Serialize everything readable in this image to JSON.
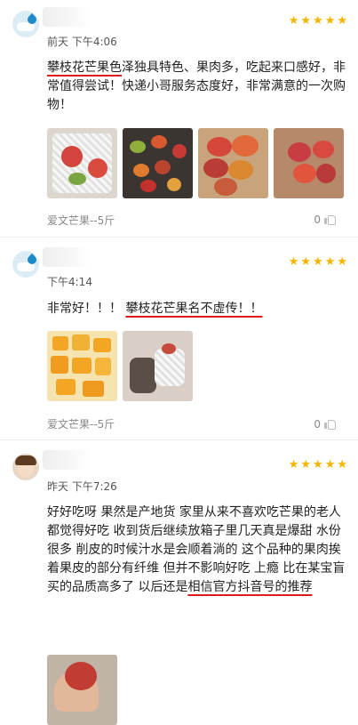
{
  "reviews": [
    {
      "date": "前天 下午4:06",
      "text_parts": [
        {
          "text": "攀枝花芒果色",
          "underline": true
        },
        {
          "text": "泽独具特色、果肉多，吃起来口感好，非常值得尝试！快递小哥服务态度好，非常满意的一次购物！",
          "underline": false
        }
      ],
      "variant": "爱文芒果--5斤",
      "likes": "0",
      "image_count": 4
    },
    {
      "date": "下午4:14",
      "text_parts": [
        {
          "text": "非常好！！！ ",
          "underline": false
        },
        {
          "text": "攀枝花芒果名不虚传！！",
          "underline": true
        }
      ],
      "variant": "爱文芒果--5斤",
      "likes": "0",
      "image_count": 2
    },
    {
      "date": "昨天 下午7:26",
      "text_parts": [
        {
          "text": "好好吃呀 果然是产地货 家里从来不喜欢吃芒果的老人都觉得好吃 收到货后继续放箱子里几天真是爆甜 水份很多 削皮的时候汁水是会顺着淌的 这个品种的果肉挨着果皮的部分有纤维 但并不影响好吃 上瘾 比在某宝盲买的品质高多了 以后还是",
          "underline": false
        },
        {
          "text": "相信官方抖音号的推荐",
          "underline": true
        }
      ],
      "image_count": 1
    }
  ],
  "rating_stars": 5,
  "colors": {
    "star": "#f5b400",
    "underline": "#e21a1a",
    "meta_text": "#888888"
  }
}
